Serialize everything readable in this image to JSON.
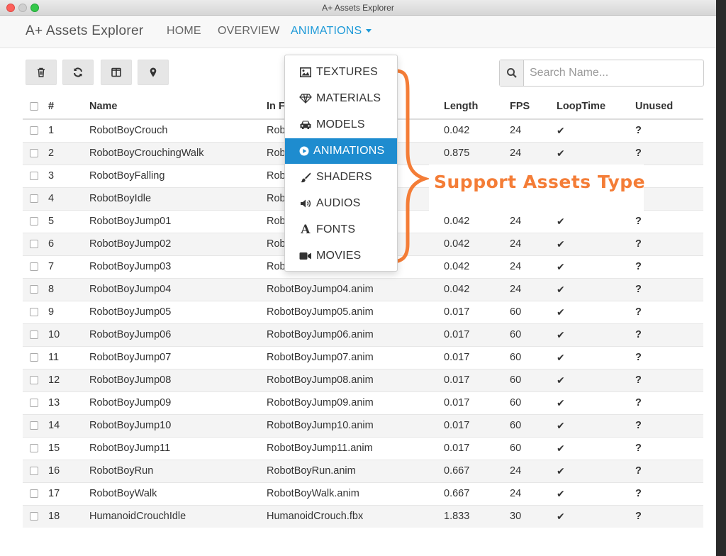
{
  "window": {
    "title": "A+ Assets Explorer"
  },
  "nav": {
    "brand": "A+ Assets Explorer",
    "links": [
      "HOME",
      "OVERVIEW",
      "ANIMATIONS"
    ],
    "active_color": "#1e9ad8"
  },
  "toolbar": {
    "buttons": [
      "trash-icon",
      "refresh-icon",
      "columns-icon",
      "map-marker-icon"
    ]
  },
  "search": {
    "placeholder": "Search Name..."
  },
  "table": {
    "headers": [
      "#",
      "Name",
      "In F",
      "Length",
      "FPS",
      "LoopTime",
      "Unused"
    ],
    "rows": [
      {
        "idx": "1",
        "name": "RobotBoyCrouch",
        "file": "Rob",
        "length": "0.042",
        "fps": "24",
        "loop": "✔",
        "unused": "?"
      },
      {
        "idx": "2",
        "name": "RobotBoyCrouchingWalk",
        "file": "Rob",
        "length": "0.875",
        "fps": "24",
        "loop": "✔",
        "unused": "?"
      },
      {
        "idx": "3",
        "name": "RobotBoyFalling",
        "file": "Rob",
        "length": "",
        "fps": "",
        "loop": "",
        "unused": ""
      },
      {
        "idx": "4",
        "name": "RobotBoyIdle",
        "file": "Rob",
        "length": "",
        "fps": "",
        "loop": "",
        "unused": ""
      },
      {
        "idx": "5",
        "name": "RobotBoyJump01",
        "file": "Rob",
        "length": "0.042",
        "fps": "24",
        "loop": "✔",
        "unused": "?"
      },
      {
        "idx": "6",
        "name": "RobotBoyJump02",
        "file": "Rob",
        "length": "0.042",
        "fps": "24",
        "loop": "✔",
        "unused": "?"
      },
      {
        "idx": "7",
        "name": "RobotBoyJump03",
        "file": "Rob",
        "length": "0.042",
        "fps": "24",
        "loop": "✔",
        "unused": "?"
      },
      {
        "idx": "8",
        "name": "RobotBoyJump04",
        "file": "RobotBoyJump04.anim",
        "length": "0.042",
        "fps": "24",
        "loop": "✔",
        "unused": "?"
      },
      {
        "idx": "9",
        "name": "RobotBoyJump05",
        "file": "RobotBoyJump05.anim",
        "length": "0.017",
        "fps": "60",
        "loop": "✔",
        "unused": "?"
      },
      {
        "idx": "10",
        "name": "RobotBoyJump06",
        "file": "RobotBoyJump06.anim",
        "length": "0.017",
        "fps": "60",
        "loop": "✔",
        "unused": "?"
      },
      {
        "idx": "11",
        "name": "RobotBoyJump07",
        "file": "RobotBoyJump07.anim",
        "length": "0.017",
        "fps": "60",
        "loop": "✔",
        "unused": "?"
      },
      {
        "idx": "12",
        "name": "RobotBoyJump08",
        "file": "RobotBoyJump08.anim",
        "length": "0.017",
        "fps": "60",
        "loop": "✔",
        "unused": "?"
      },
      {
        "idx": "13",
        "name": "RobotBoyJump09",
        "file": "RobotBoyJump09.anim",
        "length": "0.017",
        "fps": "60",
        "loop": "✔",
        "unused": "?"
      },
      {
        "idx": "14",
        "name": "RobotBoyJump10",
        "file": "RobotBoyJump10.anim",
        "length": "0.017",
        "fps": "60",
        "loop": "✔",
        "unused": "?"
      },
      {
        "idx": "15",
        "name": "RobotBoyJump11",
        "file": "RobotBoyJump11.anim",
        "length": "0.017",
        "fps": "60",
        "loop": "✔",
        "unused": "?"
      },
      {
        "idx": "16",
        "name": "RobotBoyRun",
        "file": "RobotBoyRun.anim",
        "length": "0.667",
        "fps": "24",
        "loop": "✔",
        "unused": "?"
      },
      {
        "idx": "17",
        "name": "RobotBoyWalk",
        "file": "RobotBoyWalk.anim",
        "length": "0.667",
        "fps": "24",
        "loop": "✔",
        "unused": "?"
      },
      {
        "idx": "18",
        "name": "HumanoidCrouchIdle",
        "file": "HumanoidCrouch.fbx",
        "length": "1.833",
        "fps": "30",
        "loop": "✔",
        "unused": "?"
      }
    ]
  },
  "dropdown": {
    "items": [
      {
        "label": "TEXTURES",
        "icon": "image-icon"
      },
      {
        "label": "MATERIALS",
        "icon": "diamond-icon"
      },
      {
        "label": "MODELS",
        "icon": "car-icon"
      },
      {
        "label": "ANIMATIONS",
        "icon": "play-circle-icon"
      },
      {
        "label": "SHADERS",
        "icon": "brush-icon"
      },
      {
        "label": "AUDIOS",
        "icon": "volume-icon"
      },
      {
        "label": "FONTS",
        "icon": "font-icon"
      },
      {
        "label": "MOVIES",
        "icon": "video-camera-icon"
      }
    ],
    "active_index": 3,
    "active_color": "#1e8ccf"
  },
  "annotation": {
    "text": "Support Assets Type",
    "color": "#f47d37"
  }
}
